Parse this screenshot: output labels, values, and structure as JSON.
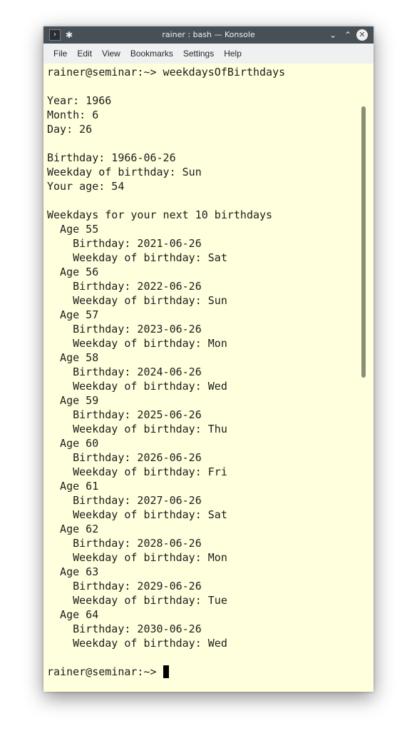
{
  "window": {
    "title": "rainer : bash — Konsole",
    "app_icon": "terminal-icon",
    "pin_icon": "pin-icon",
    "buttons": {
      "minimize": "chevron-down-icon",
      "maximize": "chevron-up-icon",
      "close": "close-icon",
      "minimize_glyph": "⌄",
      "maximize_glyph": "⌃",
      "close_glyph": "✕",
      "app_glyph": "›",
      "pin_glyph": "✱"
    }
  },
  "menu": {
    "items": [
      {
        "label": "File"
      },
      {
        "label": "Edit"
      },
      {
        "label": "View"
      },
      {
        "label": "Bookmarks"
      },
      {
        "label": "Settings"
      },
      {
        "label": "Help"
      }
    ]
  },
  "terminal": {
    "lines": [
      "rainer@seminar:~> weekdaysOfBirthdays",
      "",
      "Year: 1966",
      "Month: 6",
      "Day: 26",
      "",
      "Birthday: 1966-06-26",
      "Weekday of birthday: Sun",
      "Your age: 54",
      "",
      "Weekdays for your next 10 birthdays",
      "  Age 55",
      "    Birthday: 2021-06-26",
      "    Weekday of birthday: Sat",
      "  Age 56",
      "    Birthday: 2022-06-26",
      "    Weekday of birthday: Sun",
      "  Age 57",
      "    Birthday: 2023-06-26",
      "    Weekday of birthday: Mon",
      "  Age 58",
      "    Birthday: 2024-06-26",
      "    Weekday of birthday: Wed",
      "  Age 59",
      "    Birthday: 2025-06-26",
      "    Weekday of birthday: Thu",
      "  Age 60",
      "    Birthday: 2026-06-26",
      "    Weekday of birthday: Fri",
      "  Age 61",
      "    Birthday: 2027-06-26",
      "    Weekday of birthday: Sat",
      "  Age 62",
      "    Birthday: 2028-06-26",
      "    Weekday of birthday: Mon",
      "  Age 63",
      "    Birthday: 2029-06-26",
      "    Weekday of birthday: Tue",
      "  Age 64",
      "    Birthday: 2030-06-26",
      "    Weekday of birthday: Wed",
      ""
    ],
    "prompt": "rainer@seminar:~> "
  },
  "colors": {
    "titlebar": "#475057",
    "terminal_background": "#ffffdd",
    "terminal_text": "#1c1c1c",
    "scrollbar": "#8a8f78"
  }
}
